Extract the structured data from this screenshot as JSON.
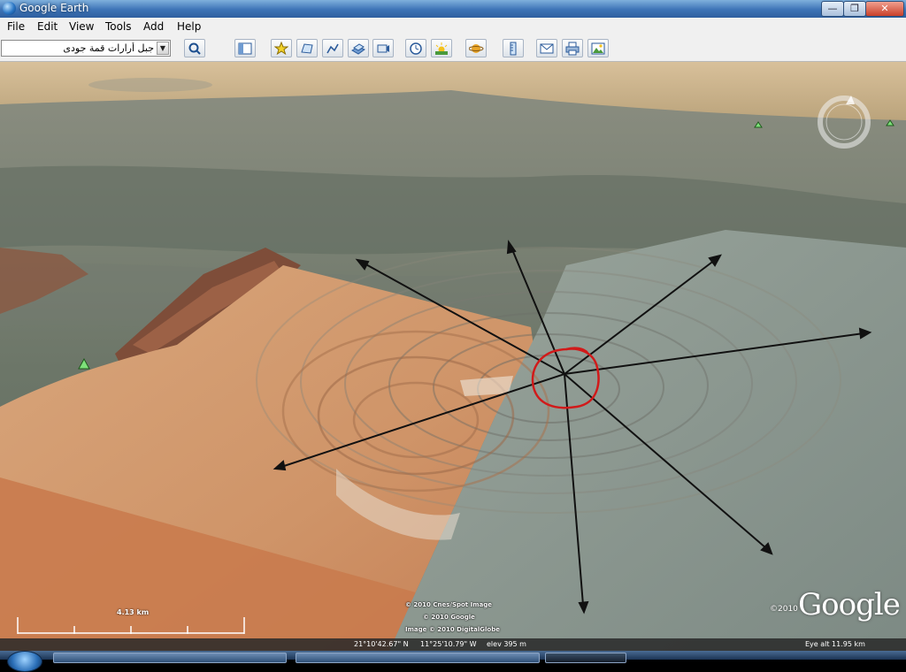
{
  "window": {
    "title": "Google Earth",
    "minimize_label": "—",
    "maximize_label": "❐",
    "close_label": "✕"
  },
  "menu": {
    "items": [
      "File",
      "Edit",
      "View",
      "Tools",
      "Add",
      "Help"
    ]
  },
  "search": {
    "value": "جبل أرارات قمة جودى"
  },
  "toolbar": {
    "icons": [
      "search-icon",
      "sidebar-toggle-icon",
      "placemark-icon",
      "polygon-icon",
      "path-icon",
      "image-overlay-icon",
      "record-tour-icon",
      "historical-imagery-icon",
      "sunlight-icon",
      "planets-icon",
      "ruler-icon",
      "email-icon",
      "print-icon",
      "save-image-icon"
    ]
  },
  "map": {
    "attribution": [
      "© 2010 Cnes/Spot Image",
      "© 2010 Google",
      "Image © 2010 DigitalGlobe"
    ],
    "google_logo": "Google",
    "logo_year": "©2010",
    "scale_label": "4.13 km",
    "status_coords_lat": "21°10'42.67\" N",
    "status_coords_lon": "11°25'10.79\" W",
    "status_elev": "elev  395 m",
    "status_eye": "Eye alt  11.95 km",
    "colors": {
      "annotation_circle": "#d11a1a",
      "arrows": "#111111",
      "sand": "#d69a6c",
      "rock": "#6e7a6e"
    }
  }
}
